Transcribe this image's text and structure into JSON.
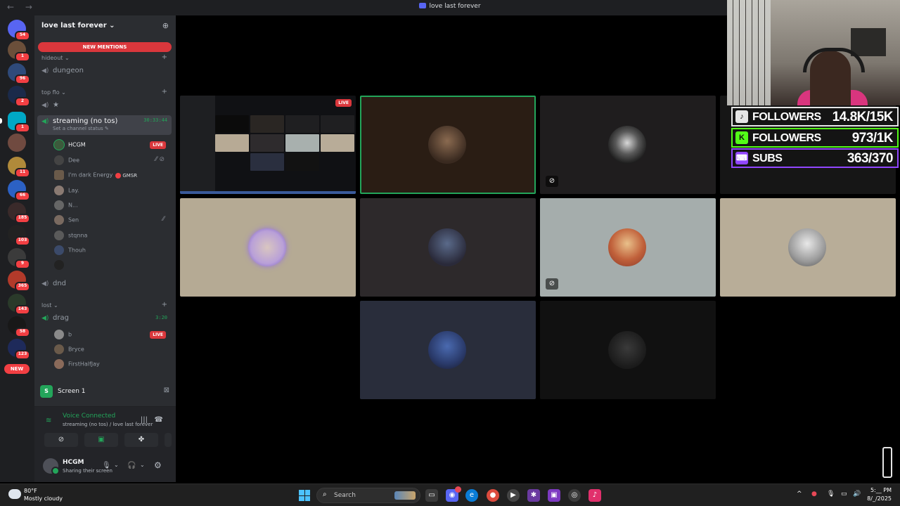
{
  "window": {
    "title": "love last forever",
    "nav": "← →"
  },
  "rail": {
    "badges": [
      "54",
      "1",
      "96",
      "2",
      "1",
      "11",
      "66",
      "185",
      "103",
      "9",
      "365",
      "143",
      "58",
      "123"
    ],
    "new_label": "NEW"
  },
  "sidebar": {
    "guild_name": "love last forever ⌄",
    "new_mentions": "NEW MENTIONS",
    "categories": {
      "hideout": "hideout ⌄",
      "top_flo": "top flo ⌄",
      "lost": "lost ⌄"
    },
    "channels": {
      "dungeon": "dungeon",
      "star": "★",
      "streaming": "streaming (no tos)",
      "streaming_timer": "30:33:44",
      "streaming_status": "Set a channel status ✎",
      "dnd": "dnd",
      "drag": "drag",
      "drag_timer": "3:20"
    },
    "members": [
      {
        "name": "HCGM",
        "live": "LIVE"
      },
      {
        "name": "Dee"
      },
      {
        "name": "I'm dark Energy",
        "tag": "GMSR"
      },
      {
        "name": "Lay."
      },
      {
        "name": "N..."
      },
      {
        "name": "Sen"
      },
      {
        "name": "stqnna"
      },
      {
        "name": "Thouh"
      },
      {
        "name": ""
      }
    ],
    "drag_members": [
      {
        "name": "b",
        "live": "LIVE"
      },
      {
        "name": "Bryce"
      },
      {
        "name": "FirstHalfJay"
      }
    ],
    "screen_panel": {
      "label": "Screen 1"
    },
    "voice": {
      "title": "Voice Connected",
      "subtitle": "streaming (no tos) / love last forever"
    },
    "user": {
      "name": "HCGM",
      "status": "Sharing their screen"
    }
  },
  "stream_tile": {
    "live": "LIVE"
  },
  "overlay": {
    "stats": [
      {
        "label": "FOLLOWERS",
        "value": "14.8K/15K",
        "color": "#e5e5e5",
        "icon": "tiktok-icon"
      },
      {
        "label": "FOLLOWERS",
        "value": "973/1K",
        "color": "#53fc18",
        "icon": "kick-icon"
      },
      {
        "label": "SUBS",
        "value": "363/370",
        "color": "#9146ff",
        "icon": "twitch-icon"
      }
    ]
  },
  "taskbar": {
    "weather_temp": "80°F",
    "weather_desc": "Mostly cloudy",
    "search": "Search",
    "clock_time": "5:__ PM",
    "clock_date": "8/_/2025"
  },
  "colors": {
    "accent_green": "#23a55a",
    "live_red": "#da373c",
    "discord_bg": "#2b2d31",
    "rail_bg": "#1e1f22"
  }
}
